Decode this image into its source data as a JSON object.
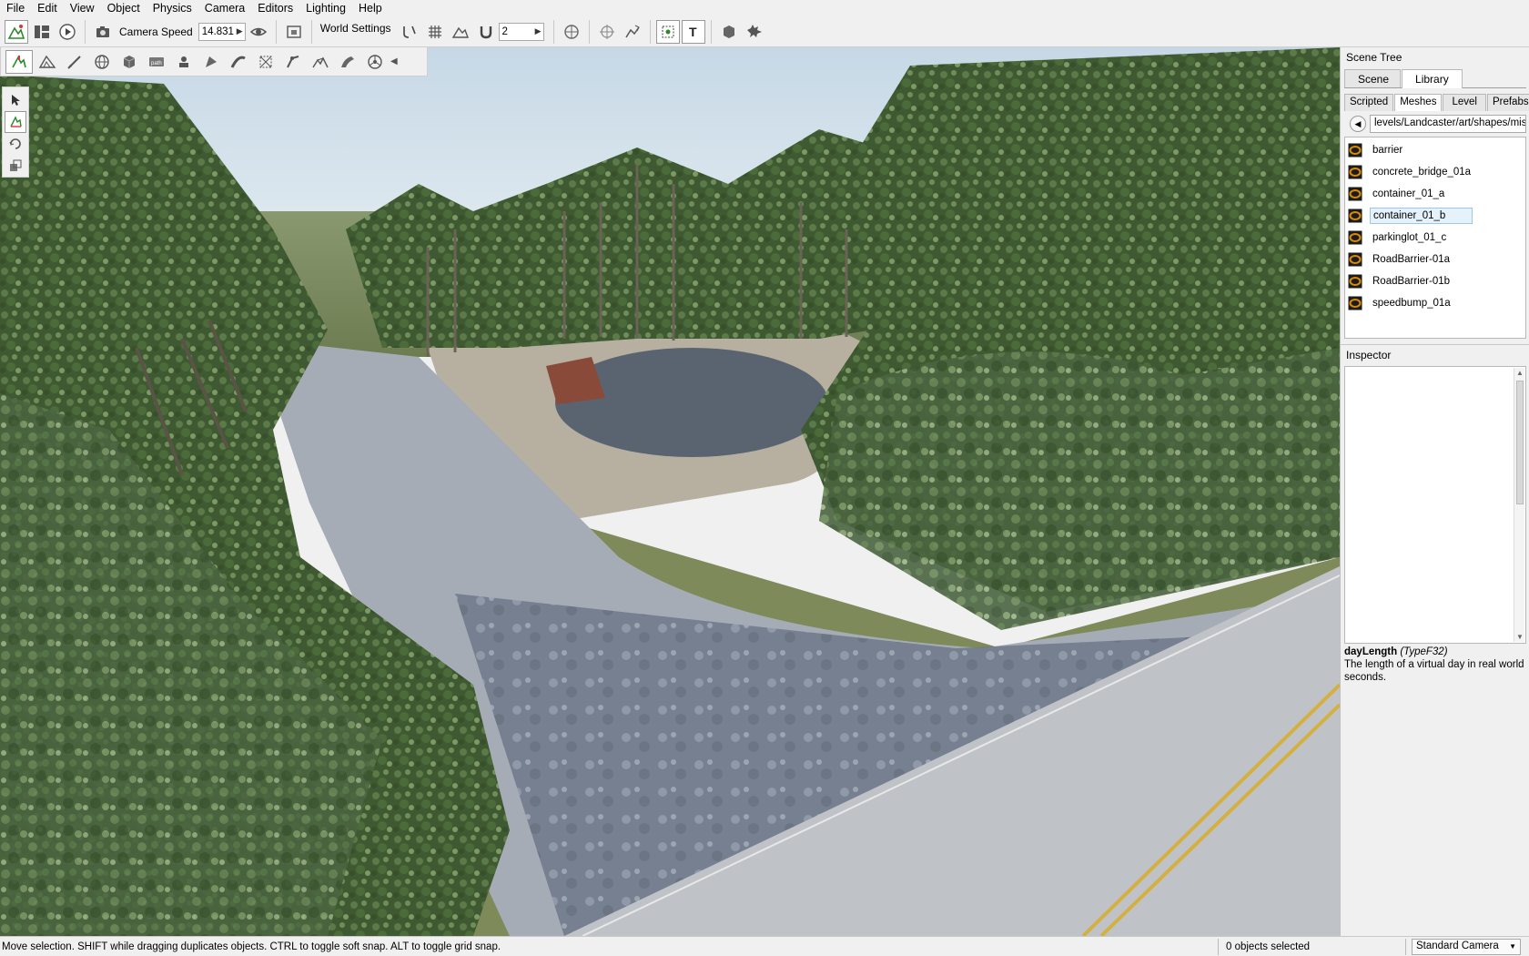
{
  "menu": [
    "File",
    "Edit",
    "View",
    "Object",
    "Physics",
    "Camera",
    "Editors",
    "Lighting",
    "Help"
  ],
  "toolbar": {
    "camera_speed_label": "Camera Speed",
    "camera_speed_value": "14.831",
    "world_settings_label": "World Settings",
    "grid_size_value": "2"
  },
  "scene_tree": {
    "title": "Scene Tree",
    "tabs": [
      "Scene",
      "Library"
    ],
    "selected_tab": "Library",
    "sub_tabs": [
      "Scripted",
      "Meshes",
      "Level",
      "Prefabs"
    ],
    "selected_sub_tab": "Meshes",
    "path": "levels/Landcaster/art/shapes/misc",
    "items": [
      "barrier",
      "concrete_bridge_01a",
      "container_01_a",
      "container_01_b",
      "parkinglot_01_c",
      "RoadBarrier-01a",
      "RoadBarrier-01b",
      "speedbump_01a"
    ],
    "selected_item": "container_01_b"
  },
  "inspector": {
    "title": "Inspector",
    "doc_field": "dayLength",
    "doc_type": "(TypeF32)",
    "doc_text": "The length of a virtual day in real world seconds."
  },
  "status": {
    "message": "Move selection.  SHIFT while dragging duplicates objects.  CTRL to toggle soft snap.  ALT to toggle grid snap.",
    "selection_count": "0 objects selected",
    "camera_mode": "Standard Camera"
  },
  "colors": {
    "accent": "#0078d7",
    "selection_bg": "#e5f1fb",
    "mesh_icon": "#e08a00"
  }
}
